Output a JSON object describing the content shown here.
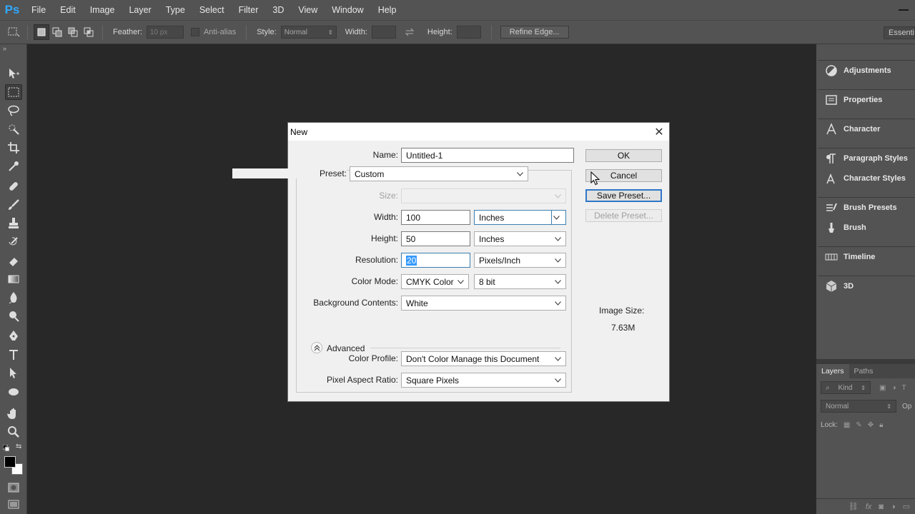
{
  "app": {
    "logo": "Ps",
    "menu": [
      "File",
      "Edit",
      "Image",
      "Layer",
      "Type",
      "Select",
      "Filter",
      "3D",
      "View",
      "Window",
      "Help"
    ]
  },
  "options_bar": {
    "feather_label": "Feather:",
    "feather_value": "10 px",
    "antialias_label": "Anti-alias",
    "style_label": "Style:",
    "style_value": "Normal",
    "width_label": "Width:",
    "height_label": "Height:",
    "refine_edge_label": "Refine Edge...",
    "workspace_label": "Essentials"
  },
  "panels": {
    "items": [
      {
        "label": "Adjustments",
        "icon": "adjustments-icon"
      },
      {
        "label": "Properties",
        "icon": "properties-icon"
      },
      {
        "label": "Character",
        "icon": "character-icon"
      },
      {
        "label": "Paragraph Styles",
        "icon": "paragraph-styles-icon"
      },
      {
        "label": "Character Styles",
        "icon": "character-styles-icon"
      },
      {
        "label": "Brush Presets",
        "icon": "brush-presets-icon"
      },
      {
        "label": "Brush",
        "icon": "brush-icon"
      },
      {
        "label": "Timeline",
        "icon": "timeline-icon"
      },
      {
        "label": "3D",
        "icon": "3d-icon"
      }
    ]
  },
  "layers": {
    "tabs": [
      "Layers",
      "Paths"
    ],
    "kind_label": "Kind",
    "blend_mode": "Normal",
    "opacity_label": "Op",
    "lock_label": "Lock:"
  },
  "dialog": {
    "title": "New",
    "name_label": "Name:",
    "name_value": "Untitled-1",
    "preset_label": "Preset:",
    "preset_value": "Custom",
    "size_label": "Size:",
    "size_value": "",
    "width_label": "Width:",
    "width_value": "100",
    "width_unit": "Inches",
    "height_label": "Height:",
    "height_value": "50",
    "height_unit": "Inches",
    "resolution_label": "Resolution:",
    "resolution_value": "20",
    "resolution_unit": "Pixels/Inch",
    "color_mode_label": "Color Mode:",
    "color_mode_value": "CMYK Color",
    "bit_depth_value": "8 bit",
    "background_label": "Background Contents:",
    "background_value": "White",
    "advanced_label": "Advanced",
    "color_profile_label": "Color Profile:",
    "color_profile_value": "Don't Color Manage this Document",
    "pixel_aspect_label": "Pixel Aspect Ratio:",
    "pixel_aspect_value": "Square Pixels",
    "ok_label": "OK",
    "cancel_label": "Cancel",
    "save_preset_label": "Save Preset...",
    "delete_preset_label": "Delete Preset...",
    "image_size_label": "Image Size:",
    "image_size_value": "7.63M"
  },
  "colors": {
    "foreground": "#000000",
    "background": "#ffffff",
    "accent": "#31a8ff",
    "selection": "#3399ff"
  }
}
